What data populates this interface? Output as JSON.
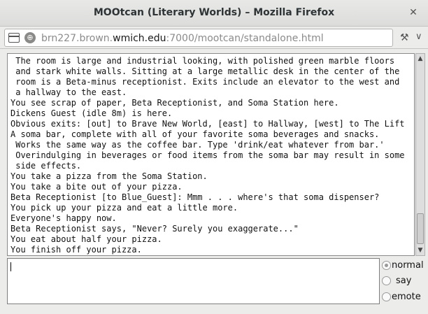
{
  "window": {
    "title": "MOOtcan (Literary Worlds) – Mozilla Firefox",
    "close_symbol": "✕"
  },
  "navbar": {
    "url_prefix": "brn227.brown.",
    "url_domain": "wmich.edu",
    "url_suffix": ":7000/mootcan/standalone.html",
    "icons": [
      "tab-icon",
      "globe-icon",
      "addon-icon",
      "chevron-down-icon"
    ]
  },
  "output": {
    "lines": [
      " The room is large and industrial looking, with polished green marble floors",
      " and stark white walls. Sitting at a large metallic desk in the center of the",
      " room is a Beta-minus receptionist. Exits include an elevator to the west and",
      " a hallway to the east.",
      "You see scrap of paper, Beta Receptionist, and Soma Station here.",
      "Dickens Guest (idle 8m) is here.",
      "Obvious exits: [out] to Brave New World, [east] to Hallway, [west] to The Lift",
      "A soma bar, complete with all of your favorite soma beverages and snacks.",
      " Works the same way as the coffee bar. Type 'drink/eat whatever from bar.'",
      " Overindulging in beverages or food items from the soma bar may result in some",
      " side effects.",
      "You take a pizza from the Soma Station.",
      "You take a bite out of your pizza.",
      "Beta Receptionist [to Blue_Guest]: Mmm . . . where's that soma dispenser?",
      "You pick up your pizza and eat a little more.",
      "Everyone's happy now.",
      "Beta Receptionist says, \"Never? Surely you exaggerate...\"",
      "You eat about half your pizza.",
      "You finish off your pizza."
    ]
  },
  "input": {
    "value": ""
  },
  "modes": {
    "options": [
      "normal",
      "say",
      "emote"
    ],
    "selected": "normal"
  }
}
